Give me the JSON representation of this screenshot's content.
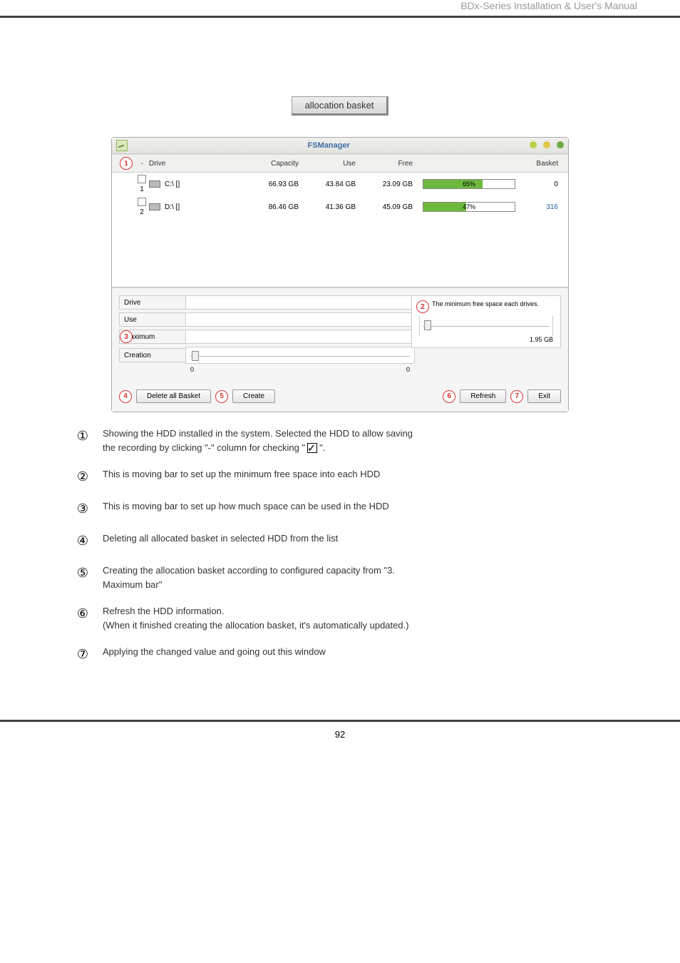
{
  "header": "BDx-Series Installation & User's Manual",
  "page_number": "92",
  "alloc_button": "allocation basket",
  "fsmanager": {
    "title": "FSManager",
    "table": {
      "headers": {
        "drive": "Drive",
        "capacity": "Capacity",
        "use": "Use",
        "free": "Free",
        "basket": "Basket"
      },
      "rows": [
        {
          "idx": "1",
          "drive": "C:\\ []",
          "capacity": "66.93 GB",
          "use": "43.84 GB",
          "free": "23.09 GB",
          "pct": "65%",
          "pctval": 65,
          "basket": "0",
          "basketClass": ""
        },
        {
          "idx": "2",
          "drive": "D:\\ []",
          "capacity": "86.46 GB",
          "use": "41.36 GB",
          "free": "45.09 GB",
          "pct": "47%",
          "pctval": 47,
          "basket": "316",
          "basketClass": "basket-blue"
        }
      ]
    },
    "lower": {
      "drive_label": "Drive",
      "use_label": "Use",
      "maximum_label": "Maximum",
      "creation_label": "Creation",
      "creation_min": "0",
      "creation_max": "0",
      "min_free_title": "The minimum free space each drives.",
      "min_free_value": "1.95 GB"
    },
    "buttons": {
      "delete": "Delete all Basket",
      "create": "Create",
      "refresh": "Refresh",
      "exit": "Exit"
    }
  },
  "desc": {
    "i1a": "Showing the HDD installed in the system. Selected the HDD to allow saving",
    "i1b": "the recording by clicking \"-\" column for checking \"",
    "i1c": "\".",
    "i2": "This is moving bar to set up the minimum free space into each HDD",
    "i3": "This is moving bar to set up how much space can be used in the HDD",
    "i4": "Deleting all allocated basket in selected HDD from the list",
    "i5a": "Creating the allocation basket according to configured capacity from \"3.",
    "i5b": "Maximum bar\"",
    "i6a": "Refresh the HDD information.",
    "i6b": "(When it finished creating the allocation basket, it's automatically updated.)",
    "i7": "Applying the changed value and going out this window"
  }
}
